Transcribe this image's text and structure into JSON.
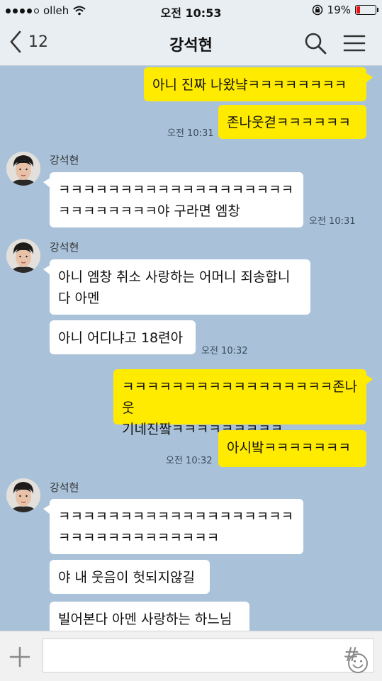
{
  "status_bar": {
    "carrier": "olleh",
    "time": "오전 10:53",
    "battery": "19%",
    "battery_level": 0.19
  },
  "header": {
    "back_count": "12",
    "title": "강석현"
  },
  "messages": {
    "m1": "아니 진짜 나왔냨ㅋㅋㅋㅋㅋㅋㅋㅋ",
    "m2": "존나웃겯ㅋㅋㅋㅋㅋㅋ",
    "m2_time": "오전 10:31",
    "g1_name": "강석현",
    "m3_line1": "ㅋㅋㅋㅋㅋㅋㅋㅋㅋㅋㅋㅋㅋㅋㅋㅋㅋㅋㅋ",
    "m3_line2": "ㅋㅋㅋㅋㅋㅋㅋㅋ야 구라면 엠창",
    "m3_time": "오전 10:31",
    "g2_name": "강석현",
    "m4_line1": "아니 엠창 취소 사랑하는 어머니 죄송합니",
    "m4_line2": "다 아멘",
    "m5": "아니 어디냐고 18련아",
    "m5_time": "오전 10:32",
    "m6_line1": "ㅋㅋㅋㅋㅋㅋㅋㅋㅋㅋㅋㅋㅋㅋㅋㅋㅋ존나웃",
    "m6_line2": "기네진짴ㅋㅋㅋㅋㅋㅋㅋㅋㅋ",
    "m7": "아시밬ㅋㅋㅋㅋㅋㅋㅋ",
    "m7_time": "오전 10:32",
    "g3_name": "강석현",
    "m8_line1": "ㅋㅋㅋㅋㅋㅋㅋㅋㅋㅋㅋㅋㅋㅋㅋㅋㅋㅋㅋ",
    "m8_line2": "ㅋㅋㅋㅋㅋㅋㅋㅋㅋㅋㅋㅋㅋ",
    "m9": "야 내 웃음이 헛되지않길",
    "m10": "빌어본다 아멘 사랑하는 하느님"
  },
  "input": {
    "placeholder": ""
  },
  "icons": {
    "back": "chevron-left-icon",
    "search": "search-icon",
    "menu": "hamburger-menu-icon",
    "plus": "plus-icon",
    "emoji": "emoji-icon",
    "hash": "hash-icon",
    "hash_glyph": "#"
  },
  "colors": {
    "chat_background": "#a9c2d9",
    "my_bubble": "#ffeb00",
    "their_bubble": "#ffffff"
  }
}
